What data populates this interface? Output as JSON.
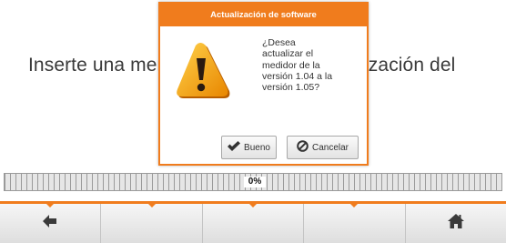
{
  "background": {
    "message": "Inserte una memoria USB con la actualización del"
  },
  "dialog": {
    "title": "Actualización de software",
    "message_lines": [
      "¿Desea",
      "actualizar el",
      "medidor de la",
      "versión 1.04 a la",
      "versión 1.05?"
    ],
    "ok_label": "Bueno",
    "cancel_label": "Cancelar",
    "icon": "warning-icon"
  },
  "progress": {
    "label": "0%",
    "value": 0
  },
  "toolbar": {
    "left_icon": "arrow-left-icon",
    "right_icon": "home-icon"
  },
  "colors": {
    "accent": "#f07c1d",
    "warning": "#f5a300"
  }
}
